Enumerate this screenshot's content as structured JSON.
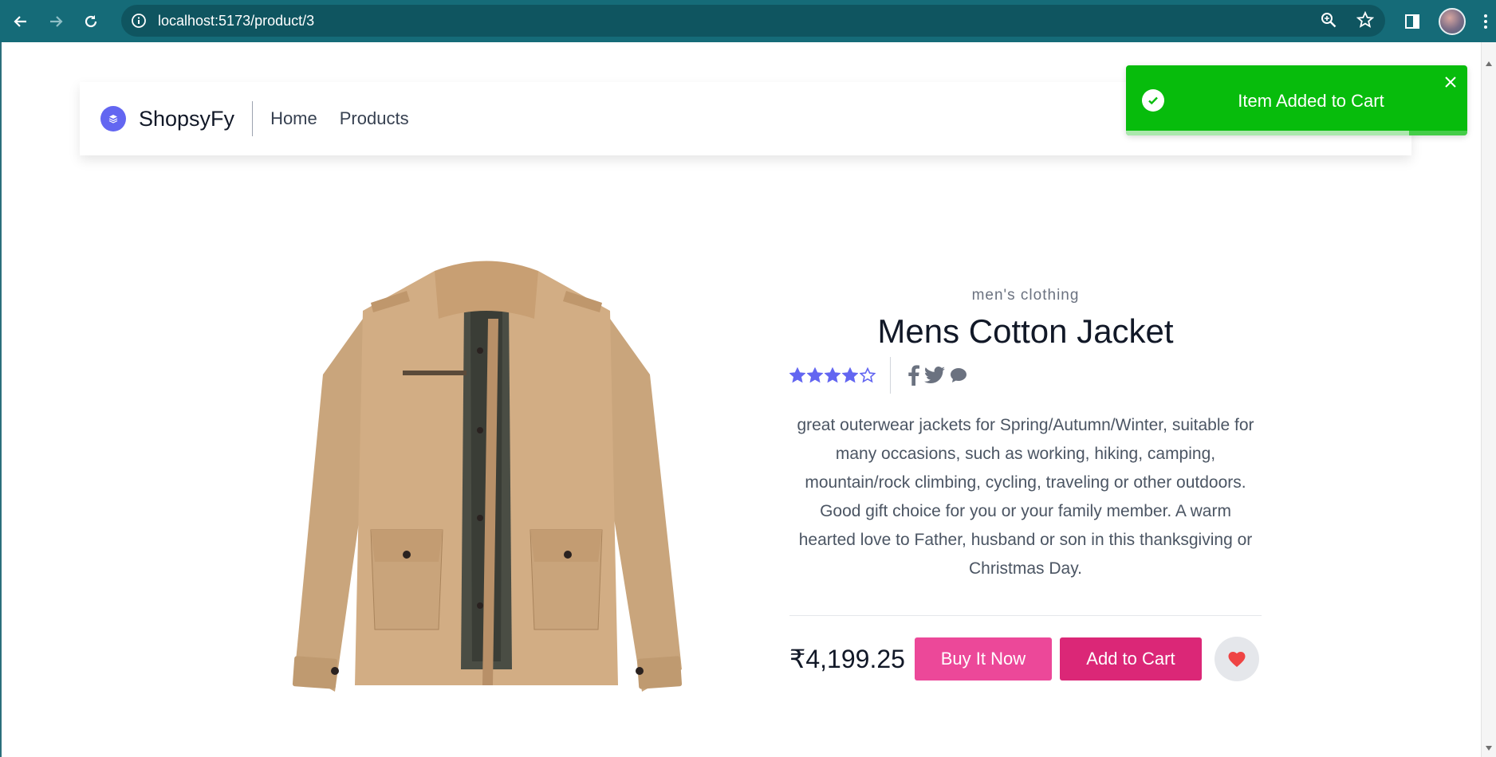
{
  "browser": {
    "url": "localhost:5173/product/3"
  },
  "navbar": {
    "brand": "ShopsyFy",
    "links": [
      "Home",
      "Products"
    ]
  },
  "toast": {
    "message": "Item Added to Cart",
    "progress": 0.83,
    "color": "#07bc0c"
  },
  "product": {
    "category": "men's clothing",
    "title": "Mens Cotton Jacket",
    "rating": 4,
    "rating_max": 5,
    "description": "great outerwear jackets for Spring/Autumn/Winter, suitable for many occasions, such as working, hiking, camping, mountain/rock climbing, cycling, traveling or other outdoors. Good gift choice for you or your family member. A warm hearted love to Father, husband or son in this thanksgiving or Christmas Day.",
    "price": "₹4,199.25",
    "buy_label": "Buy It Now",
    "cart_label": "Add to Cart",
    "social_icons": [
      "facebook-icon",
      "twitter-icon",
      "chat-icon"
    ]
  },
  "colors": {
    "accent": "#6366f1",
    "buy_button": "#ec4899",
    "cart_button": "#db2777",
    "chrome": "#156b78",
    "wishlist_heart": "#ef4444"
  }
}
